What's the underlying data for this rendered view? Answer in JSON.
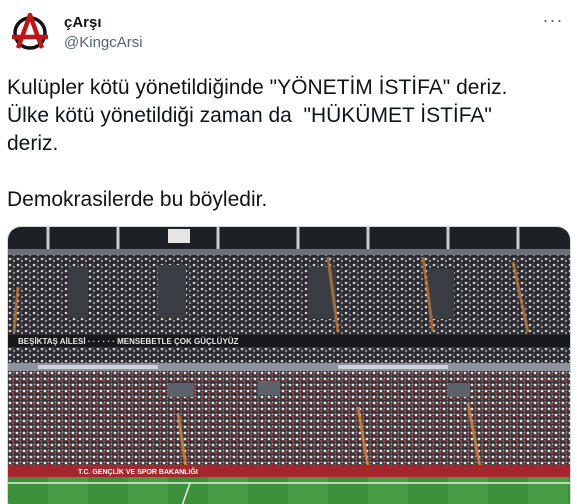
{
  "author": {
    "display_name": "çArşı",
    "handle": "@KingcArsi",
    "avatar_icon": "anarchy-a-icon"
  },
  "menu": {
    "more_label": "···"
  },
  "tweet": {
    "lines": [
      "Kulüpler kötü yönetildiğinde \"YÖNETİM İSTİFA\" deriz.",
      "Ülke kötü yönetildiği zaman da  \"HÜKÜMET İSTİFA\"",
      "deriz.",
      "Demokrasilerde bu böyledir."
    ]
  },
  "media": {
    "banner_upper": "BEŞİKTAŞ AİLESİ · · · · · · MENSEBETLE ÇOK GÜÇLÜYÜZ",
    "banner_lower": "T.C. GENÇLİK VE SPOR BAKANLIĞI",
    "colors": {
      "seats": "#2b2b30",
      "crowd_red": "#b23a3a",
      "pitch": "#3e8f3a",
      "roof": "#c9ccd2"
    }
  }
}
